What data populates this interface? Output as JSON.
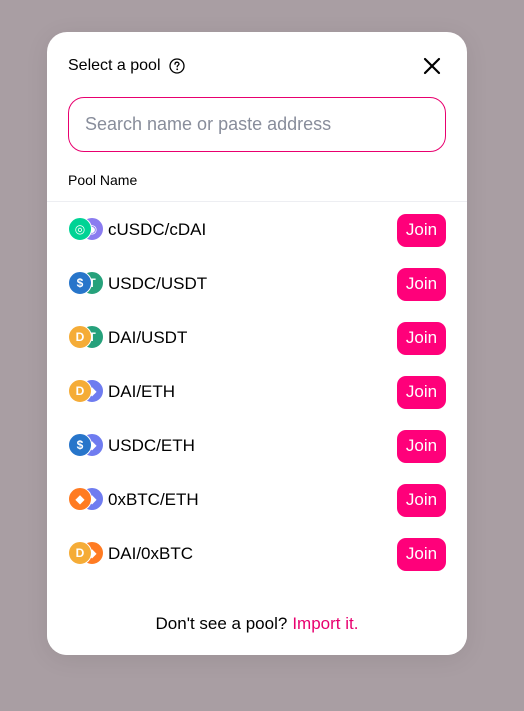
{
  "modal": {
    "title": "Select a pool",
    "search_placeholder": "Search name or paste address",
    "column_header": "Pool Name",
    "join_label": "Join",
    "footer_text": "Don't see a pool?",
    "footer_link": "Import it."
  },
  "colors": {
    "accent": "#ff007a",
    "backdrop": "#a99ea3"
  },
  "pools": [
    {
      "name": "cUSDC/cDAI",
      "token_a": "cusdc-icon",
      "token_b": "cdai-icon"
    },
    {
      "name": "USDC/USDT",
      "token_a": "usdc-icon",
      "token_b": "usdt-icon"
    },
    {
      "name": "DAI/USDT",
      "token_a": "dai-icon",
      "token_b": "usdt-icon"
    },
    {
      "name": "DAI/ETH",
      "token_a": "dai-icon",
      "token_b": "eth-icon"
    },
    {
      "name": "USDC/ETH",
      "token_a": "usdc-icon",
      "token_b": "eth-icon"
    },
    {
      "name": "0xBTC/ETH",
      "token_a": "0xbtc-icon",
      "token_b": "eth-icon"
    },
    {
      "name": "DAI/0xBTC",
      "token_a": "dai-icon",
      "token_b": "0xbtc-icon"
    }
  ]
}
